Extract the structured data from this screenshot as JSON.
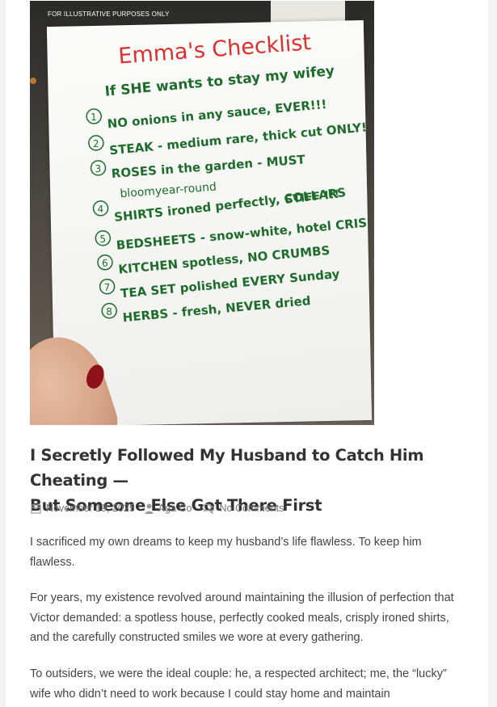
{
  "image": {
    "watermark": "FOR ILLUSTRATIVE PURPOSES ONLY",
    "paper_heading": "Emma's Checklist",
    "paper_subheading": "If SHE wants to stay my wifey",
    "checklist": [
      {
        "num": "1",
        "text": "NO onions in any sauce, EVER!!!"
      },
      {
        "num": "2",
        "text": "STEAK - medium rare, thick cut ONLY!"
      },
      {
        "num": "3",
        "text": "ROSES in the garden - MUST"
      },
      {
        "num": "",
        "text": "bloomyear-round"
      },
      {
        "num": "4",
        "text": "SHIRTS ironed perfectly, COLLARS"
      },
      {
        "num": "",
        "text": "STIFF !!!"
      },
      {
        "num": "5",
        "text": "BEDSHEETS - snow-white, hotel CRISP !"
      },
      {
        "num": "6",
        "text": "KITCHEN spotless, NO CRUMBS"
      },
      {
        "num": "7",
        "text": "TEA SET polished EVERY Sunday"
      },
      {
        "num": "8",
        "text": "HERBS - fresh, NEVER dried"
      }
    ],
    "colors": {
      "red": "#d8312f",
      "green": "#1f6b2c"
    }
  },
  "post": {
    "title_line1": "I Secretly Followed My Husband to Catch Him Cheating —",
    "title_line2": "But Someone Else Got There First",
    "date": "November 19, 2025",
    "author": "Aga Co",
    "comments": "No Comments",
    "icons": [
      "calendar-icon",
      "user-icon",
      "comments-icon"
    ]
  },
  "article": {
    "paragraphs": [
      "I sacrificed my own dreams to keep my husband’s life flawless. To keep him flawless.",
      "For years, my existence revolved around maintaining the illusion of perfection that Victor demanded: a spotless house, perfectly cooked meals, crisply ironed shirts, and the carefully constructed smiles we wore at every gathering.",
      "To outsiders, we were the ideal couple: he, a respected architect; me, the “lucky” wife who didn’t need to work because I could stay home and maintain"
    ]
  }
}
